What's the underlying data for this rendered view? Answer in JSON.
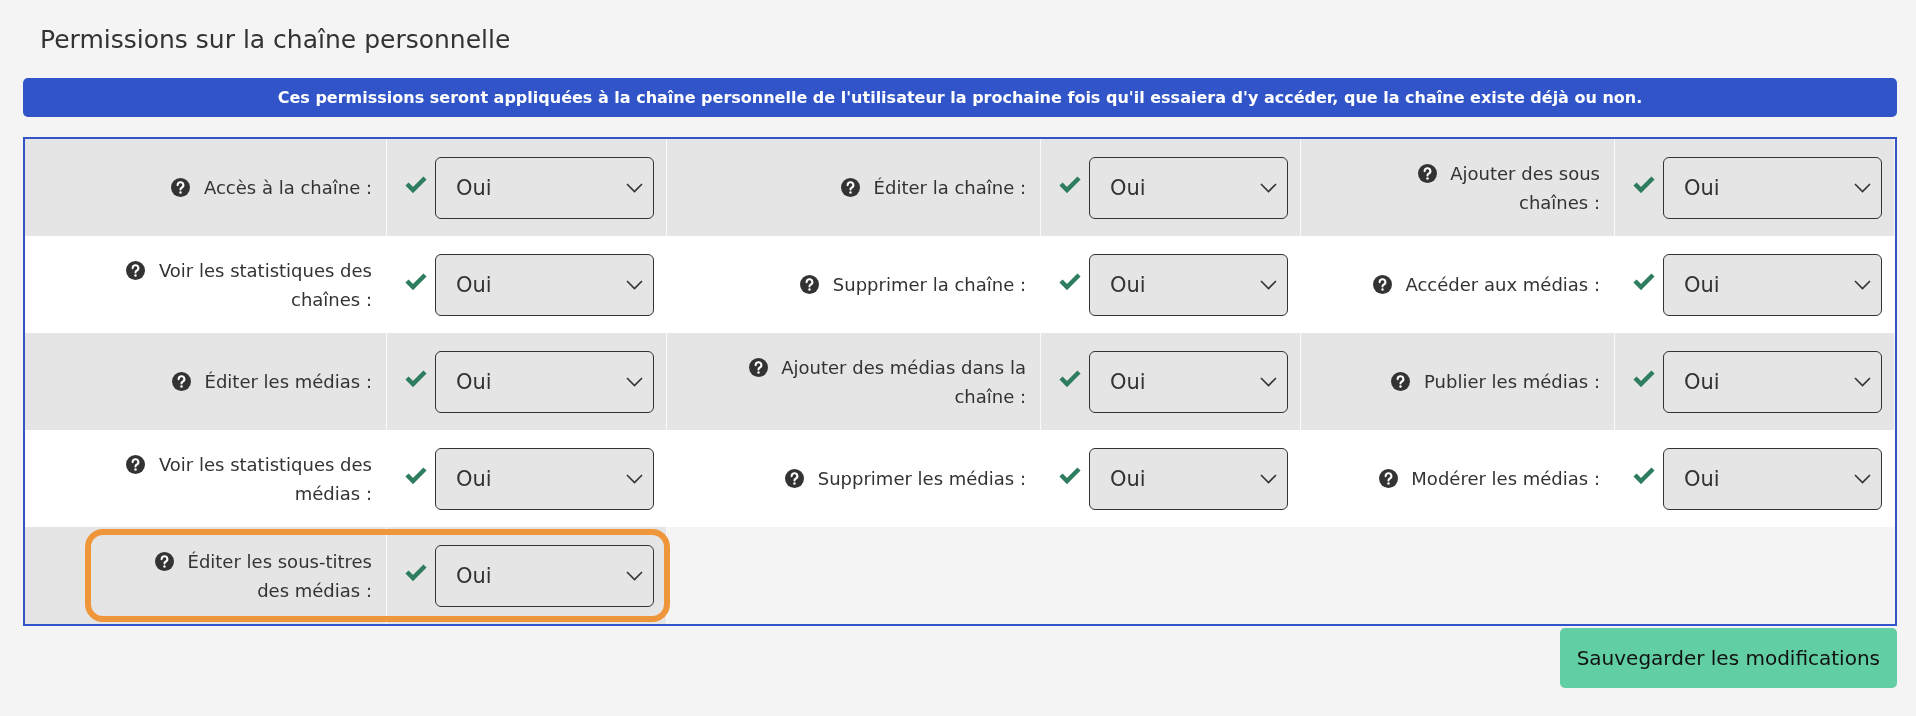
{
  "title": "Permissions sur la chaîne personnelle",
  "info_banner": "Ces permissions seront appliquées à la chaîne personnelle de l'utilisateur la prochaine fois qu'il essaiera d'y accéder, que la chaîne existe déjà ou non.",
  "permissions": [
    {
      "label": "Accès à la chaîne :",
      "value": "Oui",
      "checked": true,
      "highlighted": false
    },
    {
      "label": "Éditer la chaîne :",
      "value": "Oui",
      "checked": true,
      "highlighted": false
    },
    {
      "label": "Ajouter des sous chaînes :",
      "value": "Oui",
      "checked": true,
      "highlighted": false
    },
    {
      "label": "Voir les statistiques des chaînes :",
      "value": "Oui",
      "checked": true,
      "highlighted": false
    },
    {
      "label": "Supprimer la chaîne :",
      "value": "Oui",
      "checked": true,
      "highlighted": false
    },
    {
      "label": "Accéder aux médias :",
      "value": "Oui",
      "checked": true,
      "highlighted": false
    },
    {
      "label": "Éditer les médias :",
      "value": "Oui",
      "checked": true,
      "highlighted": false
    },
    {
      "label": "Ajouter des médias dans la chaîne :",
      "value": "Oui",
      "checked": true,
      "highlighted": false
    },
    {
      "label": "Publier les médias :",
      "value": "Oui",
      "checked": true,
      "highlighted": false
    },
    {
      "label": "Voir les statistiques des médias :",
      "value": "Oui",
      "checked": true,
      "highlighted": false
    },
    {
      "label": "Supprimer les médias :",
      "value": "Oui",
      "checked": true,
      "highlighted": false
    },
    {
      "label": "Modérer les médias :",
      "value": "Oui",
      "checked": true,
      "highlighted": false
    },
    {
      "label": "Éditer les sous-titres des médias :",
      "value": "Oui",
      "checked": true,
      "highlighted": true
    }
  ],
  "save_button": "Sauvegarder les modifications"
}
